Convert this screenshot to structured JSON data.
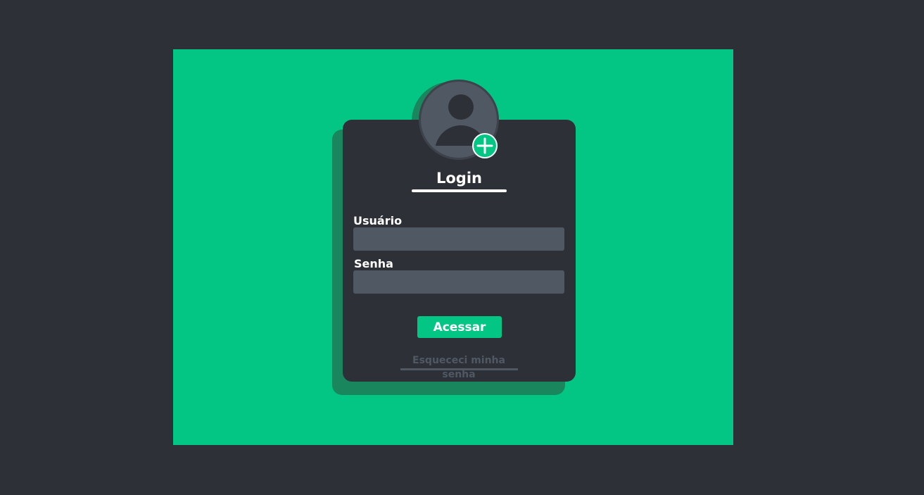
{
  "login_card": {
    "title": "Login",
    "username_label": "Usuário",
    "username_value": "",
    "password_label": "Senha",
    "password_value": "",
    "submit_label": "Acessar",
    "forgot_password_label": "Esquececi minha senha"
  },
  "avatar": {
    "icon": "user-avatar-icon",
    "badge_icon": "plus-icon"
  },
  "colors": {
    "background": "#2e3038",
    "accent_green": "#04c684",
    "shadow_green": "#19865e",
    "card": "#2e3038",
    "input": "#505863",
    "text": "#ffffff",
    "muted_link": "#505863"
  }
}
